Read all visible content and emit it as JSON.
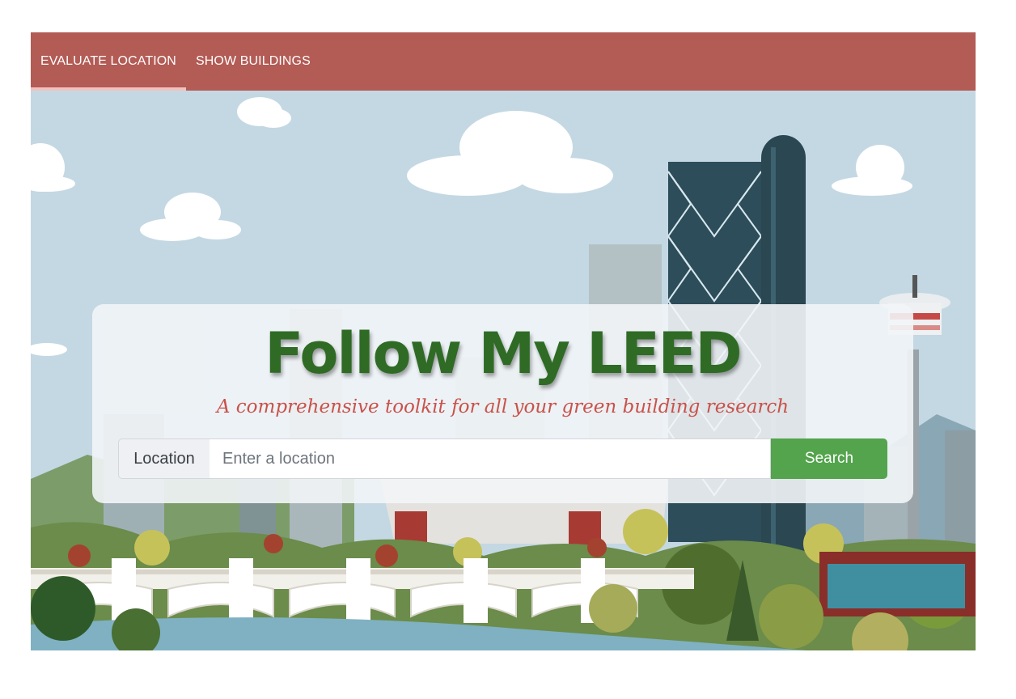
{
  "nav": {
    "tabs": [
      {
        "label": "EVALUATE LOCATION",
        "active": true
      },
      {
        "label": "SHOW BUILDINGS",
        "active": false
      }
    ]
  },
  "hero": {
    "title": "Follow My LEED",
    "subtitle": "A comprehensive toolkit for all your green building research"
  },
  "search": {
    "label": "Location",
    "placeholder": "Enter a location",
    "value": "",
    "button_label": "Search"
  },
  "colors": {
    "navbar": "#b35b55",
    "title": "#2f6b25",
    "subtitle": "#c9524a",
    "search_button": "#53a44d"
  }
}
